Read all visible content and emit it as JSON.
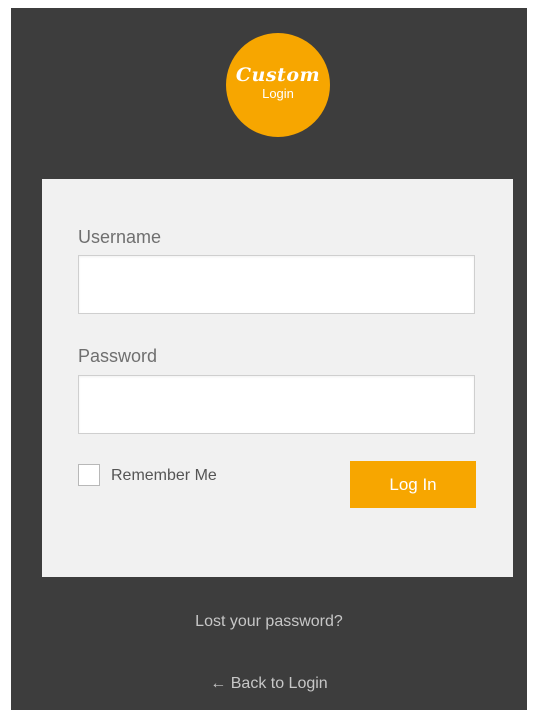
{
  "logo": {
    "script_text": "Custom",
    "sub_text": "Login"
  },
  "form": {
    "username_label": "Username",
    "username_value": "",
    "password_label": "Password",
    "password_value": "",
    "remember_label": "Remember Me",
    "remember_checked": false,
    "login_button": "Log In"
  },
  "links": {
    "lost_password": "Lost your password?",
    "back_to_login": "← Back to Login"
  },
  "colors": {
    "accent": "#f7a600",
    "background": "#3d3d3d",
    "card": "#f1f1f1"
  }
}
